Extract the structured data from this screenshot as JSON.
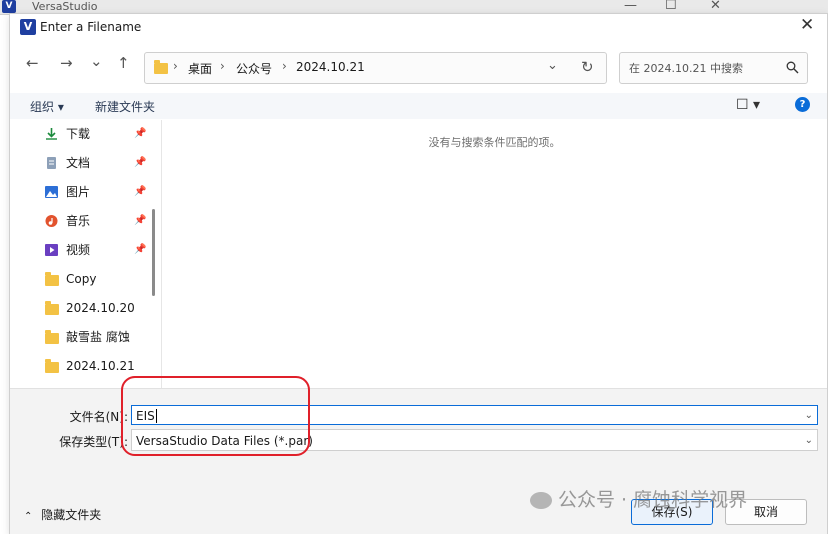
{
  "background_app": {
    "title": "VersaStudio",
    "logo_glyph": "V",
    "controls": [
      "—",
      "☐",
      "✕"
    ]
  },
  "dialog": {
    "title": "Enter a Filename",
    "logo_glyph": "V",
    "close_glyph": "✕"
  },
  "nav_buttons": {
    "back": "←",
    "forward": "→",
    "recent": "⌄",
    "up": "↑",
    "refresh": "↻"
  },
  "address": {
    "crumbs": [
      "桌面",
      "公众号",
      "2024.10.21"
    ],
    "separator": "›",
    "dropdown": "⌄"
  },
  "search": {
    "placeholder": "在 2024.10.21 中搜索",
    "icon": "search-icon"
  },
  "toolbar": {
    "organize_label": "组织 ▾",
    "new_folder_label": "新建文件夹",
    "view_glyph": "☐ ▾",
    "help_glyph": "?"
  },
  "navpane": {
    "items": [
      {
        "label": "下载",
        "icon": "download-icon",
        "pinned": true
      },
      {
        "label": "文档",
        "icon": "document-icon",
        "pinned": true
      },
      {
        "label": "图片",
        "icon": "pictures-icon",
        "pinned": true
      },
      {
        "label": "音乐",
        "icon": "music-icon",
        "pinned": true
      },
      {
        "label": "视频",
        "icon": "video-icon",
        "pinned": true
      },
      {
        "label": "Copy",
        "icon": "folder-icon",
        "pinned": false
      },
      {
        "label": "2024.10.20",
        "icon": "folder-icon",
        "pinned": false
      },
      {
        "label": "敲雪盐 腐蚀",
        "icon": "folder-icon",
        "pinned": false
      },
      {
        "label": "2024.10.21",
        "icon": "folder-icon",
        "pinned": false
      }
    ],
    "pin_glyph": "📌"
  },
  "content": {
    "empty_message": "没有与搜索条件匹配的项。"
  },
  "fields": {
    "filename_label": "文件名(N):",
    "filename_value": "EIS",
    "filetype_label": "保存类型(T):",
    "filetype_value": "VersaStudio Data Files (*.par)"
  },
  "footer": {
    "hide_folders_label": "隐藏文件夹",
    "save_label": "保存(S)",
    "cancel_label": "取消"
  },
  "watermark": {
    "text": "公众号 · 腐蚀科学视界"
  },
  "colors": {
    "accent": "#0a6cd8",
    "annotation": "#e0202a",
    "folder": "#f3c244"
  }
}
